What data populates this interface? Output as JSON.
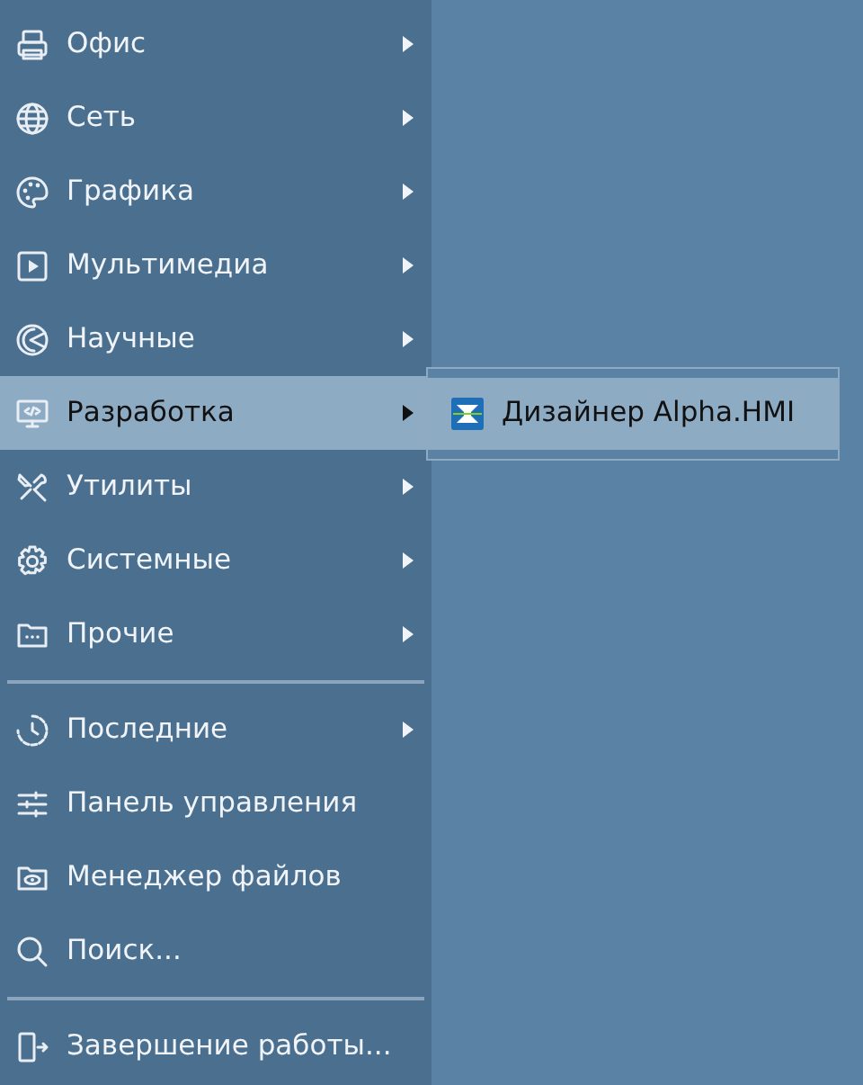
{
  "menu": {
    "sections": [
      [
        {
          "label": "Офис",
          "has_submenu": true,
          "selected": false
        },
        {
          "label": "Сеть",
          "has_submenu": true,
          "selected": false
        },
        {
          "label": "Графика",
          "has_submenu": true,
          "selected": false
        },
        {
          "label": "Мультимедиа",
          "has_submenu": true,
          "selected": false
        },
        {
          "label": "Научные",
          "has_submenu": true,
          "selected": false
        },
        {
          "label": "Разработка",
          "has_submenu": true,
          "selected": true
        },
        {
          "label": "Утилиты",
          "has_submenu": true,
          "selected": false
        },
        {
          "label": "Системные",
          "has_submenu": true,
          "selected": false
        },
        {
          "label": "Прочие",
          "has_submenu": true,
          "selected": false
        }
      ],
      [
        {
          "label": "Последние",
          "has_submenu": true,
          "selected": false
        },
        {
          "label": "Панель управления",
          "has_submenu": false,
          "selected": false
        },
        {
          "label": "Менеджер файлов",
          "has_submenu": false,
          "selected": false
        },
        {
          "label": "Поиск...",
          "has_submenu": false,
          "selected": false
        }
      ],
      [
        {
          "label": "Завершение работы...",
          "has_submenu": false,
          "selected": false
        }
      ]
    ]
  },
  "submenu": {
    "items": [
      {
        "label": "Дизайнер Alpha.HMI",
        "selected": true
      }
    ]
  }
}
